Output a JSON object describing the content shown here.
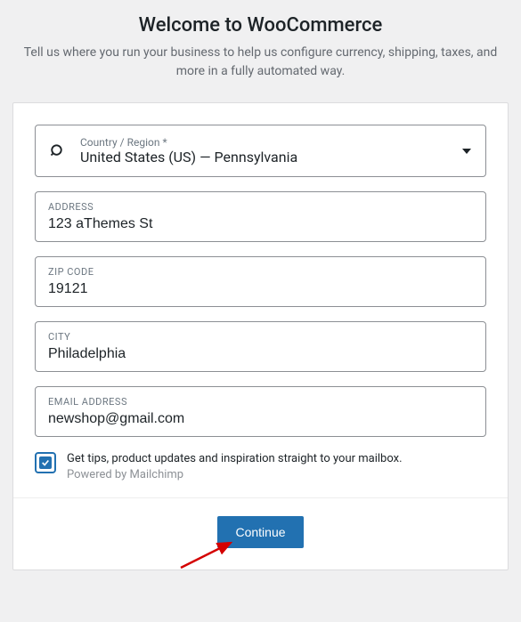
{
  "header": {
    "title": "Welcome to WooCommerce",
    "subtitle": "Tell us where you run your business to help us configure currency, shipping, taxes, and more in a fully automated way."
  },
  "form": {
    "country": {
      "label": "Country / Region *",
      "value": "United States (US) — Pennsylvania"
    },
    "address": {
      "label": "ADDRESS",
      "value": "123 aThemes St"
    },
    "zip": {
      "label": "ZIP CODE",
      "value": "19121"
    },
    "city": {
      "label": "CITY",
      "value": "Philadelphia"
    },
    "email": {
      "label": "EMAIL ADDRESS",
      "value": "newshop@gmail.com"
    },
    "optin": {
      "line1": "Get tips, product updates and inspiration straight to your mailbox.",
      "line2": "Powered by Mailchimp"
    }
  },
  "footer": {
    "continue": "Continue"
  }
}
